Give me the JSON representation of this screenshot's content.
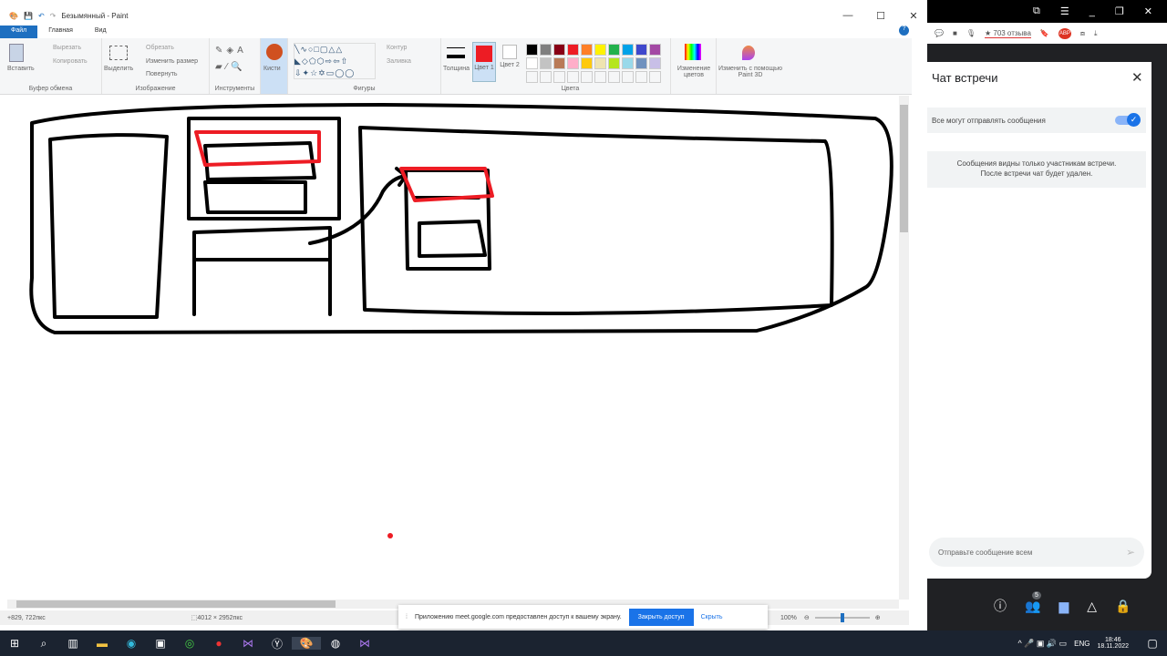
{
  "paint": {
    "title": "Безымянный - Paint",
    "tabs": [
      "Файл",
      "Главная",
      "Вид"
    ],
    "clipboard": {
      "paste": "Вставить",
      "cut": "Вырезать",
      "copy": "Копировать",
      "label": "Буфер обмена"
    },
    "image": {
      "select": "Выделить",
      "crop": "Обрезать",
      "resize": "Изменить размер",
      "rotate": "Повернуть",
      "label": "Изображение"
    },
    "tools": {
      "label": "Инструменты"
    },
    "brushes": "Кисти",
    "shapes": {
      "label": "Фигуры",
      "outline": "Контур",
      "fill": "Заливка"
    },
    "thickness": "Толщина",
    "color1": "Цвет 1",
    "color2": "Цвет 2",
    "colors_label": "Цвета",
    "edit_colors": "Изменение цветов",
    "paint3d": "Изменить с помощью Paint 3D",
    "palette": [
      "#000000",
      "#7f7f7f",
      "#880015",
      "#ed1c24",
      "#ff7f27",
      "#fff200",
      "#22b14c",
      "#00a2e8",
      "#3f48cc",
      "#a349a4",
      "#ffffff",
      "#c3c3c3",
      "#b97a57",
      "#ffaec9",
      "#ffc90e",
      "#efe4b0",
      "#b5e61d",
      "#99d9ea",
      "#7092be",
      "#c8bfe7"
    ],
    "status": {
      "cursor": "829, 722пкс",
      "size": "4012 × 2952пкс",
      "zoom": "100%"
    }
  },
  "share_bar": {
    "message": "Приложению meet.google.com предоставлен доступ к вашему экрану.",
    "stop": "Закрыть доступ",
    "hide": "Скрыть"
  },
  "browser": {
    "reviews": "★ 703 отзыва"
  },
  "chat": {
    "title": "Чат встречи",
    "toggle_label": "Все могут отправлять сообщения",
    "toggle_on": true,
    "notice_line1": "Сообщения видны только участникам встречи.",
    "notice_line2": "После встречи чат будет удален.",
    "input_placeholder": "Отправьте сообщение всем",
    "participants": "5"
  },
  "taskbar": {
    "lang": "ENG",
    "time": "18:46",
    "date": "18.11.2022"
  }
}
